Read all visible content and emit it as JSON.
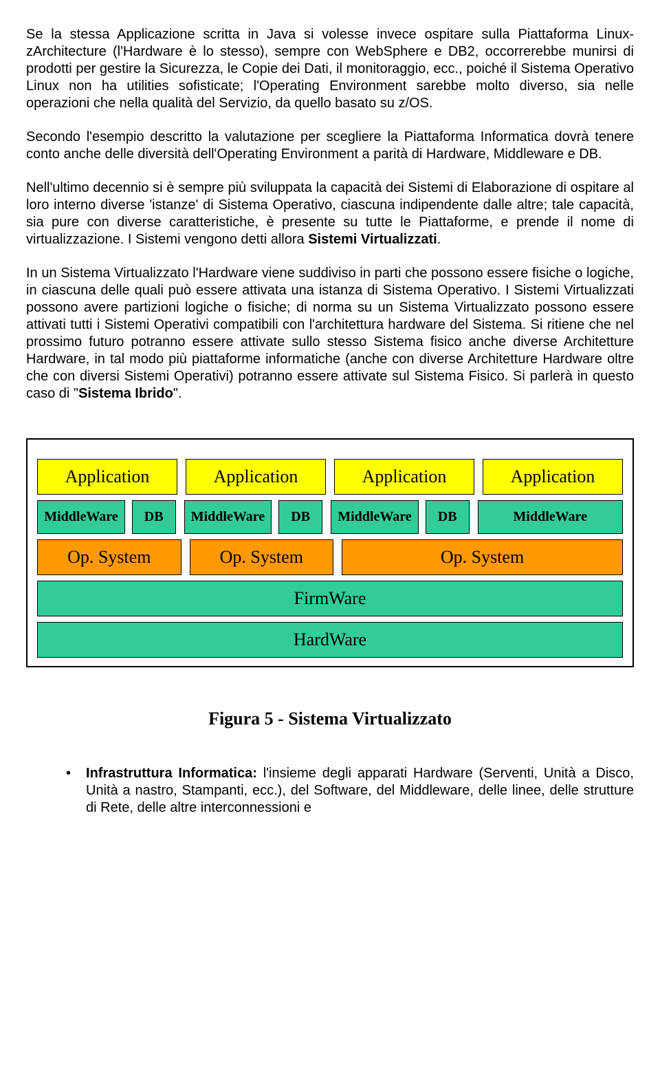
{
  "paragraphs": {
    "p1_a": "Se la stessa Applicazione scritta in Java si volesse invece ospitare sulla Piattaforma Linux-zArchitecture (l'Hardware è lo stesso), sempre con WebSphere e DB2, occorrerebbe munirsi di prodotti per gestire la Sicurezza, le Copie dei Dati, il monitoraggio, ecc., poiché il Sistema Operativo Linux non ha utilities sofisticate; l'Operating Environment sarebbe molto diverso, sia nelle operazioni che nella qualità del Servizio, da quello basato su z/OS.",
    "p2": "Secondo l'esempio descritto la valutazione per scegliere la Piattaforma Informatica dovrà tenere conto anche delle diversità dell'Operating Environment a parità di Hardware, Middleware e DB.",
    "p3_a": "Nell'ultimo decennio si è sempre più sviluppata la capacità dei Sistemi di Elaborazione di ospitare al loro interno diverse 'istanze' di Sistema Operativo, ciascuna indipendente dalle altre; tale capacità, sia pure con diverse caratteristiche, è presente su tutte le Piattaforme, e prende il nome di virtualizzazione. I Sistemi vengono detti allora ",
    "p3_b": "Sistemi Virtualizzati",
    "p3_c": ".",
    "p4_a": "In un Sistema Virtualizzato l'Hardware viene suddiviso in parti che possono essere fisiche o logiche, in ciascuna delle quali può essere attivata una istanza di Sistema Operativo. I Sistemi Virtualizzati possono avere partizioni logiche o fisiche; di norma su un Sistema Virtualizzato possono essere attivati  tutti i Sistemi Operativi compatibili con l'architettura hardware del Sistema. Si ritiene che nel prossimo futuro potranno essere attivate sullo stesso Sistema fisico anche diverse Architetture Hardware, in tal modo più piattaforme informatiche (anche con diverse Architetture Hardware oltre che con diversi Sistemi Operativi) potranno essere attivate sul Sistema Fisico. Si parlerà in questo caso di \"",
    "p4_b": "Sistema Ibrido",
    "p4_c": "\"."
  },
  "diagram": {
    "app": "Application",
    "mw": "MiddleWare",
    "db": "DB",
    "os": "Op. System",
    "fw": "FirmWare",
    "hw": "HardWare"
  },
  "caption": "Figura 5 - Sistema Virtualizzato",
  "bullet": {
    "lead_bold": "Infrastruttura Informatica: ",
    "rest": "l'insieme degli apparati Hardware (Serventi, Unità a Disco, Unità a nastro, Stampanti, ecc.), del Software, del Middleware, delle linee, delle strutture di Rete, delle altre interconnessioni e"
  }
}
